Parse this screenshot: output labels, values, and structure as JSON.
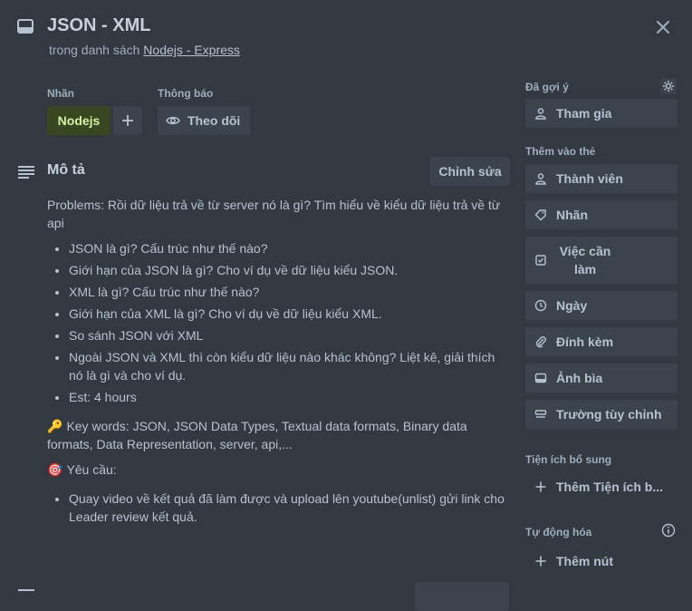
{
  "header": {
    "title": "JSON - XML",
    "list_prefix": "trong danh sách",
    "list_name": "Nodejs - Express"
  },
  "labels_section": {
    "heading": "Nhãn",
    "labels": [
      {
        "name": "Nodejs",
        "color": "#37471f",
        "text_color": "#d3f1a7"
      }
    ]
  },
  "notifications_section": {
    "heading": "Thông báo",
    "watch_label": "Theo dõi"
  },
  "description": {
    "heading": "Mô tả",
    "edit_label": "Chỉnh sửa",
    "intro": "Problems: Rồi dữ liệu trả về từ server nó là gì? Tìm hiểu về kiểu dữ liệu trả về từ api",
    "bullets": [
      "JSON là gì? Cấu trúc như thế nào?",
      "Giới hạn của JSON là gì? Cho ví dụ về dữ liệu kiểu JSON.",
      "XML là gì? Cấu trúc như thế nào?",
      "Giới hạn của XML là gì? Cho ví dụ về dữ liệu kiểu XML.",
      "So sánh JSON với XML",
      "Ngoài JSON và XML thì còn kiểu dữ liệu nào khác không? Liệt kê, giải thích nó là gì và cho ví dụ.",
      "Est: 4 hours"
    ],
    "keywords_emoji": "🔑",
    "keywords": "Key words: JSON, JSON Data Types, Textual data formats, Binary data formats, Data Representation, server, api,...",
    "requirement_emoji": "🎯",
    "requirement_heading": "Yêu cầu:",
    "requirement_bullets": [
      "Quay video về kết quả đã làm được và upload lên youtube(unlist) gửi link cho Leader review kết quả."
    ]
  },
  "sidebar": {
    "suggested_heading": "Đã gợi ý",
    "join_label": "Tham gia",
    "add_to_card_heading": "Thêm vào thẻ",
    "members_label": "Thành viên",
    "labels_label": "Nhãn",
    "checklist_label": "Việc cần làm",
    "dates_label": "Ngày",
    "attachment_label": "Đính kèm",
    "cover_label": "Ảnh bìa",
    "custom_fields_label": "Trường tùy chỉnh",
    "powerups_heading": "Tiện ích bổ sung",
    "add_powerups_label": "Thêm Tiện ích b...",
    "automation_heading": "Tự động hóa",
    "add_button_label": "Thêm nút"
  }
}
